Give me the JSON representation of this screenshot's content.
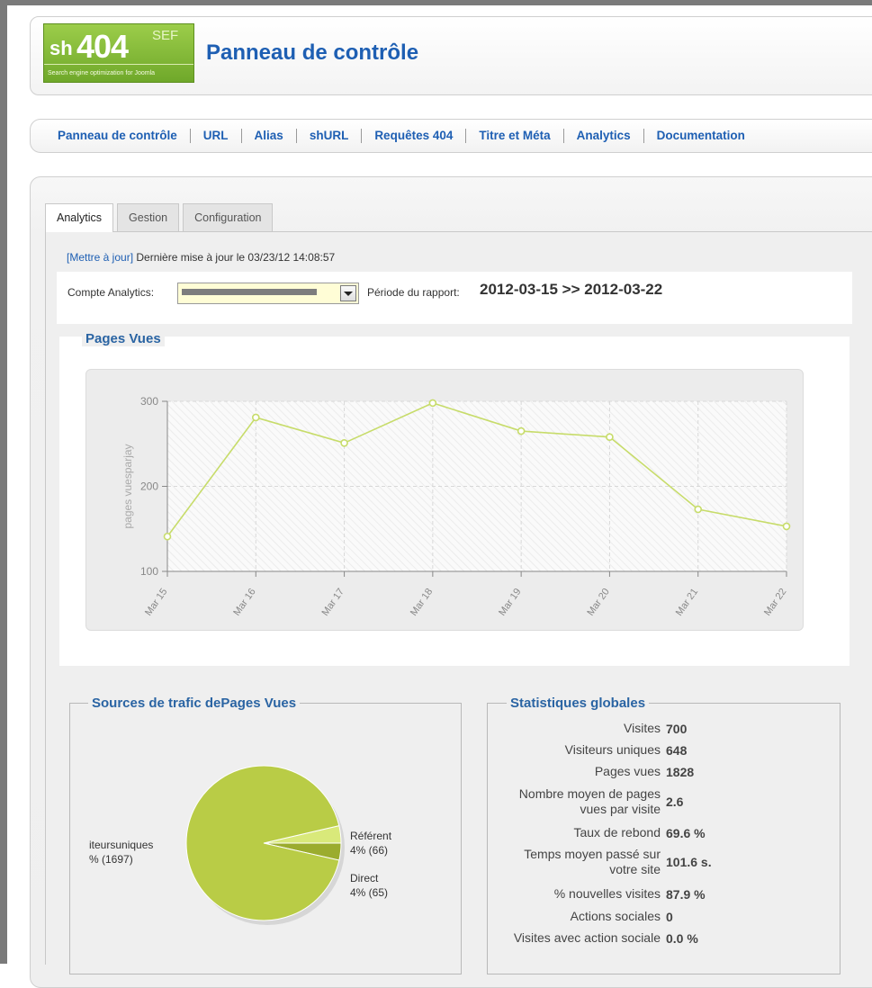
{
  "logo": {
    "sh": "sh",
    "num": "404",
    "sef": "SEF",
    "tagline": "Search engine optimization for Joomla"
  },
  "page_title": "Panneau de contrôle",
  "menu": [
    "Panneau de contrôle",
    "URL",
    "Alias",
    "shURL",
    "Requêtes 404",
    "Titre et Méta",
    "Analytics",
    "Documentation"
  ],
  "tabs": [
    "Analytics",
    "Gestion",
    "Configuration"
  ],
  "update": {
    "link": "[Mettre à jour]",
    "text": " Dernière mise à jour le 03/23/12 14:08:57"
  },
  "account": {
    "label": "Compte Analytics:",
    "selected_value": ""
  },
  "period": {
    "label": "Période du rapport:",
    "value": "2012-03-15  >>  2012-03-22"
  },
  "pageviews_title": "Pages Vues",
  "chart_data": {
    "type": "line",
    "categories": [
      "Mar 15",
      "Mar 16",
      "Mar 17",
      "Mar 18",
      "Mar 19",
      "Mar 20",
      "Mar 21",
      "Mar 22"
    ],
    "series": [
      {
        "values": [
          141,
          281,
          251,
          298,
          265,
          258,
          173,
          153
        ]
      }
    ],
    "ylabel": "pages vuesparjay",
    "ylim": [
      100,
      300
    ],
    "yticks": [
      100,
      200,
      300
    ],
    "color": "#c7dc6a",
    "grid": true
  },
  "traffic_title": "Sources de trafic dePages Vues",
  "pie": [
    {
      "label": "iteursuniques",
      "pct": "% (1697)",
      "value": 1697,
      "color": "#b9cc46"
    },
    {
      "label": "Référent",
      "pct": "4% (66)",
      "value": 66,
      "color": "#d9e97a"
    },
    {
      "label": "Direct",
      "pct": "4% (65)",
      "value": 65,
      "color": "#9bac2e"
    }
  ],
  "stats_title": "Statistiques globales",
  "stats": [
    {
      "label": "Visites",
      "value": "700"
    },
    {
      "label": "Visiteurs uniques",
      "value": "648"
    },
    {
      "label": "Pages vues",
      "value": "1828"
    },
    {
      "label": "Nombre moyen de pages vues par visite",
      "value": "2.6"
    },
    {
      "label": "Taux de rebond",
      "value": "69.6 %"
    },
    {
      "label": "Temps moyen passé sur votre site",
      "value": "101.6 s."
    },
    {
      "label": "% nouvelles visites",
      "value": "87.9 %"
    },
    {
      "label": "Actions sociales",
      "value": "0"
    },
    {
      "label": "Visites avec action sociale",
      "value": "0.0 %"
    }
  ]
}
